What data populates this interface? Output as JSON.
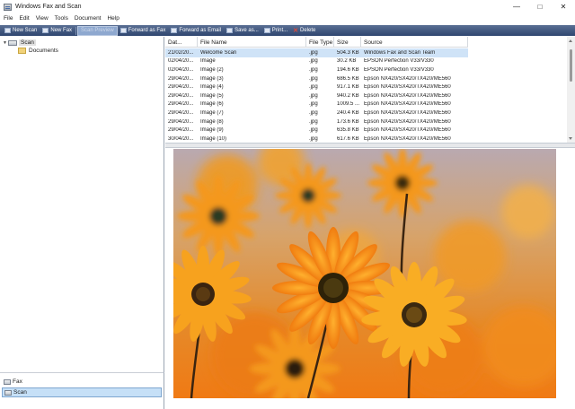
{
  "window": {
    "title": "Windows Fax and Scan"
  },
  "menu": [
    "File",
    "Edit",
    "View",
    "Tools",
    "Document",
    "Help"
  ],
  "toolbar": {
    "new_scan": "New Scan",
    "new_fax": "New Fax",
    "scan_to_fax": "Scan Preview",
    "forward_fax": "Forward as Fax",
    "forward_email": "Forward as Email",
    "save_as": "Save as...",
    "print": "Print...",
    "delete": "Delete"
  },
  "tree": {
    "root": "Scan",
    "child": "Documents"
  },
  "bottom_nav": {
    "fax": "Fax",
    "scan": "Scan"
  },
  "table": {
    "columns": [
      "Dat...",
      "File Name",
      "File Type",
      "Size",
      "Source"
    ],
    "rows": [
      [
        "21/02/20...",
        "Welcome Scan",
        ".jpg",
        "504.3 KB",
        "Windows Fax and Scan Team"
      ],
      [
        "02/04/20...",
        "Image",
        ".jpg",
        "30.2 KB",
        "EPSON Perfection V33/V330"
      ],
      [
        "02/04/20...",
        "Image (2)",
        ".jpg",
        "194.6 KB",
        "EPSON Perfection V33/V330"
      ],
      [
        "29/04/20...",
        "Image (3)",
        ".jpg",
        "686.5 KB",
        "Epson NX420/SX420/TX420/ME560"
      ],
      [
        "29/04/20...",
        "Image (4)",
        ".jpg",
        "917.1 KB",
        "Epson NX420/SX420/TX420/ME560"
      ],
      [
        "29/04/20...",
        "Image (5)",
        ".jpg",
        "940.2 KB",
        "Epson NX420/SX420/TX420/ME560"
      ],
      [
        "29/04/20...",
        "Image (6)",
        ".jpg",
        "1009.5 ...",
        "Epson NX420/SX420/TX420/ME560"
      ],
      [
        "29/04/20...",
        "Image (7)",
        ".jpg",
        "240.4 KB",
        "Epson NX420/SX420/TX420/ME560"
      ],
      [
        "29/04/20...",
        "Image (8)",
        ".jpg",
        "173.6 KB",
        "Epson NX420/SX420/TX420/ME560"
      ],
      [
        "29/04/20...",
        "Image (9)",
        ".jpg",
        "635.8 KB",
        "Epson NX420/SX420/TX420/ME560"
      ],
      [
        "30/04/20...",
        "Image (10)",
        ".jpg",
        "617.6 KB",
        "Epson NX420/SX420/TX420/ME560"
      ]
    ],
    "selected_row": 0
  },
  "colors": {
    "toolbar": "#3b5078",
    "selection": "#cfe3f7",
    "flower_petal": "#f5a623",
    "flower_center": "#3a2a10"
  }
}
